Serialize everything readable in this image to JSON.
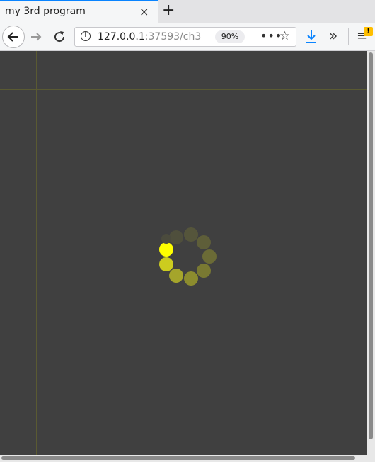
{
  "tab": {
    "title": "my 3rd program",
    "close": "×"
  },
  "new_tab": "+",
  "url": {
    "host": "127.0.0.1",
    "rest": ":37593/ch3",
    "zoom": "90%"
  },
  "toolbar": {
    "more": "•••",
    "star": "☆",
    "download": "⤓",
    "overflow": "»",
    "menu": "≡",
    "badge": "!"
  },
  "spinner": {
    "dot_colors": [
      "#ffff00",
      "#cccc1f",
      "#a5a52b",
      "#8c8c2e",
      "#797932",
      "#6b6b36",
      "#5e5e39",
      "#55553b",
      "#4f4f3c",
      "#4b4b3d"
    ]
  }
}
